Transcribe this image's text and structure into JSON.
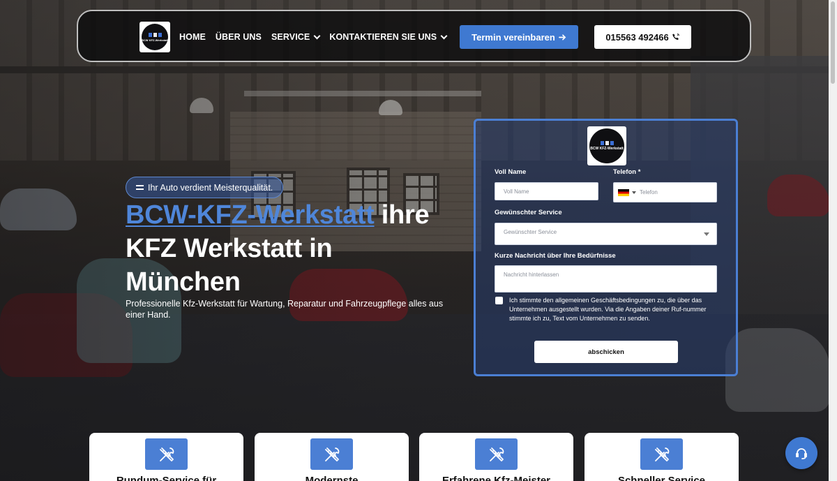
{
  "nav": {
    "logo_text": "BCW KFZ-Werkstatt",
    "links": [
      {
        "label": "HOME",
        "has_dropdown": false
      },
      {
        "label": "ÜBER UNS",
        "has_dropdown": false
      },
      {
        "label": "SERVICE",
        "has_dropdown": true
      },
      {
        "label": "KONTAKTIEREN SIE UNS",
        "has_dropdown": true
      }
    ],
    "cta_label": "Termin vereinbaren",
    "cta_icon": "arrow-right-icon",
    "phone_label": "015563 492466",
    "phone_icon": "phone-ringing-icon"
  },
  "hero": {
    "badge": "Ihr Auto verdient Meisterqualität.",
    "title_brand": "BCW-KFZ-Werkstatt",
    "title_rest": " ihre KFZ Werkstatt in München",
    "subtitle": "Professionelle Kfz-Werkstatt für Wartung, Reparatur und Fahrzeugpflege alles aus einer Hand."
  },
  "form": {
    "logo_text": "BCW KFZ-Werkstatt",
    "name_label": "Voll Name",
    "name_placeholder": "Voll Name",
    "phone_label": "Telefon *",
    "phone_placeholder": "Telefon",
    "service_label": "Gewünschter Service",
    "service_placeholder": "Gewünschter Service",
    "message_label": "Kurze Nachricht über Ihre Bedürfnisse",
    "message_placeholder": "Nachricht hinterlassen",
    "consent_text": "Ich stimmte den allgemeinen Geschäftsbedingungen zu, die über das Unternehmen ausgestellt wurden. Via die Angaben deiner Ruf-nummer stimmte ich zu, Text vom Unternehmen zu senden.",
    "submit_label": "abschicken"
  },
  "cards": [
    {
      "title": "Rundum-Service für",
      "icon": "tools-icon"
    },
    {
      "title": "Modernste",
      "icon": "tools-icon"
    },
    {
      "title": "Erfahrene Kfz-Meister",
      "icon": "tools-icon"
    },
    {
      "title": "Schneller Service",
      "icon": "tools-icon"
    }
  ],
  "colors": {
    "accent": "#3f79d1",
    "brand_text": "#4f86d9",
    "card_bg": "#ffffff"
  }
}
